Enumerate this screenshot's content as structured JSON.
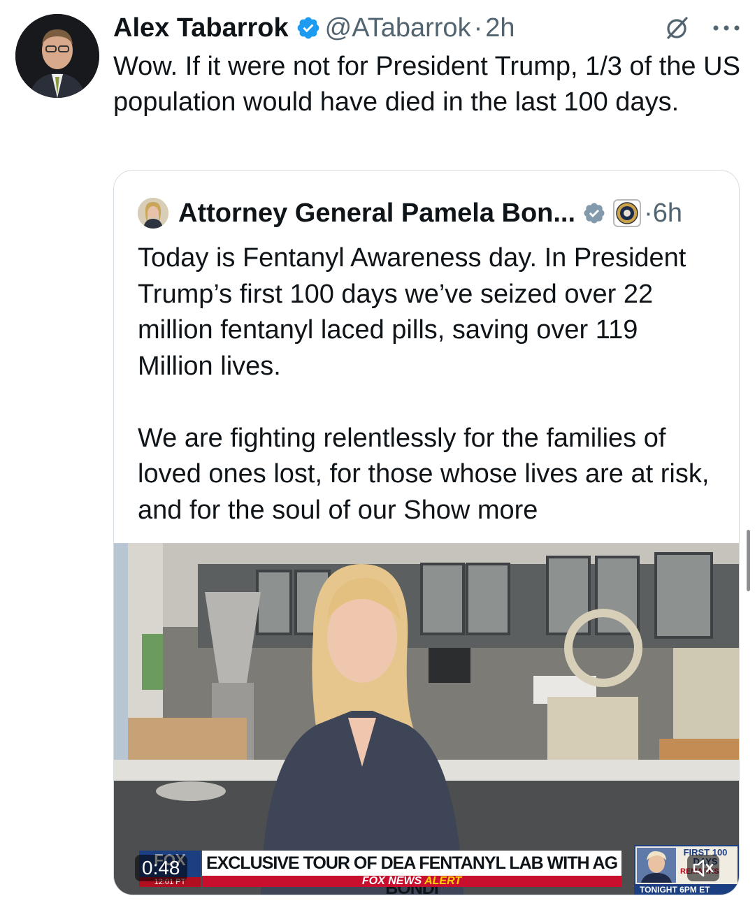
{
  "tweet": {
    "author_name": "Alex Tabarrok",
    "handle": "@ATabarrok",
    "separator": "·",
    "time": "2h",
    "text": "Wow. If it were not for President Trump, 1/3 of the US population would have died in the last 100 days.",
    "icons": [
      "verified-badge-icon",
      "grok-icon",
      "more-icon"
    ]
  },
  "quoted_tweet": {
    "author_name": "Attorney General Pamela Bon...",
    "separator": "·",
    "time": "6h",
    "text_paragraph_1": "Today is Fentanyl Awareness day. In President Trump’s first 100 days we’ve seized over 22 million fentanyl laced pills, saving over 119 Million lives.",
    "text_paragraph_2": "We are fighting relentlessly for the families of loved ones lost, for those whose lives are at risk, and for the soul of our ",
    "show_more": "Show more",
    "icons": [
      "verified-badge-icon",
      "doj-seal-icon"
    ]
  },
  "video": {
    "duration": "0:48",
    "headline": "EXCLUSIVE TOUR OF DEA FENTANYL LAB WITH AG BONDI",
    "alert_prefix": "FOX NEWS",
    "alert_word": "ALERT",
    "network_logo": "FOX",
    "network_time": "12:01 PT",
    "promo_title": "FIRST 100 DAYS",
    "promo_sub": "REMARKS",
    "promo_time": "TONIGHT 6PM ET",
    "icons": [
      "mute-icon"
    ]
  },
  "colors": {
    "text": "#0f1419",
    "secondary": "#536471",
    "verified": "#1d9bf0",
    "border": "#d6dde2",
    "fox_blue": "#1c3f82",
    "fox_red": "#c8102e"
  }
}
